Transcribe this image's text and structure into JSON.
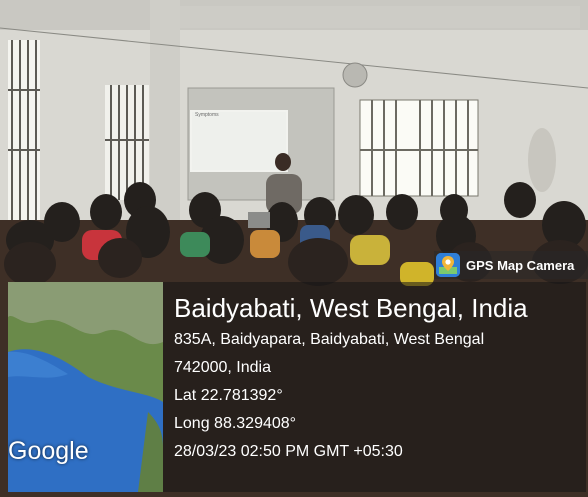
{
  "badge": {
    "label": "GPS Map Camera",
    "icon": "map-pin-icon"
  },
  "map": {
    "brand": "Google"
  },
  "location": {
    "title": "Baidyabati, West Bengal, India",
    "address_line1": "835A, Baidyapara, Baidyabati, West Bengal",
    "address_line2": "742000, India",
    "lat": "Lat 22.781392°",
    "long": "Long 88.329408°",
    "datetime": "28/03/23 02:50 PM GMT +05:30"
  },
  "slide": {
    "heading": "Symptoms"
  },
  "colors": {
    "badge_icon": "#2f7fd8",
    "map_sea": "#2f6fc4",
    "map_land": "#6a8a4a"
  }
}
